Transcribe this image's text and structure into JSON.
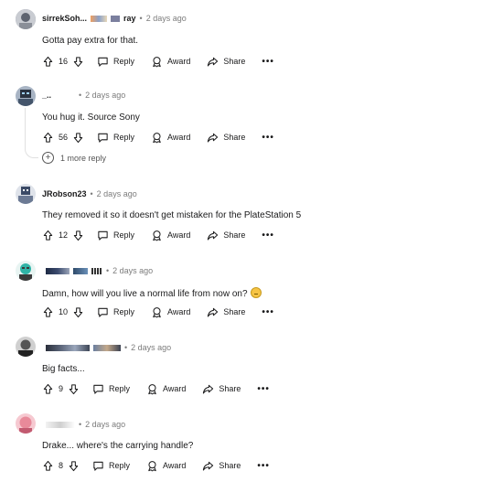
{
  "labels": {
    "reply": "Reply",
    "award": "Award",
    "share": "Share",
    "more": "•••",
    "separator": "•"
  },
  "comments": [
    {
      "username": "sirrekSoh...",
      "time": "2 days ago",
      "text": "Gotta pay extra for that.",
      "votes": "16",
      "avatar_colors": [
        "#8a8f98",
        "#c9ccd2",
        "#5e6470"
      ]
    },
    {
      "username": "_..",
      "time": "2 days ago",
      "text": "You hug it. Source Sony",
      "votes": "56",
      "avatar_colors": [
        "#44556b",
        "#a8b4c4",
        "#2a3340"
      ]
    },
    {
      "username": "JRobson23",
      "time": "2 days ago",
      "text": "They removed it so it doesn't get mistaken for the PlateStation 5",
      "votes": "12",
      "avatar_colors": [
        "#3b4a66",
        "#dfe3ea",
        "#6c7a94"
      ]
    },
    {
      "username": "",
      "time": "2 days ago",
      "text": "Damn, how will you live a normal life from now on?",
      "votes": "10",
      "avatar_colors": [
        "#2fb3a6",
        "#e8f4f2",
        "#3a3a3a"
      ]
    },
    {
      "username": "",
      "time": "2 days ago",
      "text": "Big facts...",
      "votes": "9",
      "avatar_colors": [
        "#555555",
        "#d0d0d0",
        "#222222"
      ]
    },
    {
      "username": "",
      "time": "2 days ago",
      "text": "Drake... where's the carrying handle?",
      "votes": "8",
      "avatar_colors": [
        "#e88a9a",
        "#f6c9d1",
        "#c25a70"
      ]
    }
  ],
  "more_replies": {
    "label": "1 more reply",
    "icon": "plus-circle-icon"
  },
  "icons": {
    "upvote": "arrow-up-icon",
    "downvote": "arrow-down-icon",
    "reply": "speech-bubble-icon",
    "award": "award-icon",
    "share": "share-arrow-icon"
  },
  "colors": {
    "text": "#1a1a1b",
    "meta": "#7c7c7c",
    "thread_line": "#e0e0e0"
  }
}
